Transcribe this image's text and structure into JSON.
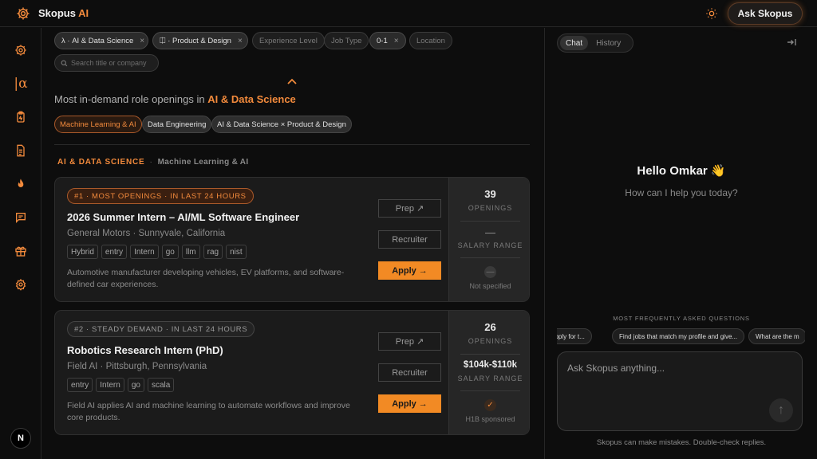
{
  "header": {
    "brand_prefix": "Skopus",
    "brand_suffix": "AI",
    "ask_button": "Ask Skopus",
    "accent": "#f28a3c"
  },
  "sidebar": {
    "items": [
      {
        "icon": "gear-icon"
      },
      {
        "icon": "alpha-icon",
        "label": "|α"
      },
      {
        "icon": "clipboard-icon"
      },
      {
        "icon": "document-icon"
      },
      {
        "icon": "flame-icon"
      },
      {
        "icon": "chat-icon"
      },
      {
        "icon": "gift-icon"
      },
      {
        "icon": "settings-icon"
      }
    ],
    "avatar": "N"
  },
  "filters": {
    "chips": [
      {
        "label": "λ · AI & Data Science",
        "active": true
      },
      {
        "label": "⎅ · Product & Design",
        "active": true
      },
      {
        "label": "Experience Level",
        "active": false
      },
      {
        "label": "Job Type",
        "active": false
      },
      {
        "label": "0-1",
        "active": true
      },
      {
        "label": "Location",
        "active": false
      }
    ],
    "remove": "×",
    "search_placeholder": "Search title or company"
  },
  "roles": {
    "heading_prefix": "Most in-demand role openings in",
    "heading_category": "AI & Data Science",
    "pills": [
      {
        "label": "Machine Learning & AI",
        "selected": true
      },
      {
        "label": "Data Engineering",
        "selected": false
      },
      {
        "label": "AI & Data Science × Product & Design",
        "selected": false
      }
    ]
  },
  "section": {
    "category": "AI & DATA SCIENCE",
    "separator": "·",
    "subcategory": "Machine Learning & AI"
  },
  "jobs": [
    {
      "badge": "#1 · MOST OPENINGS · IN LAST 24 HOURS",
      "title": "2026 Summer Intern – AI/ML Software Engineer",
      "company": "General Motors · Sunnyvale, California",
      "tags": [
        "Hybrid",
        "entry",
        "Intern",
        "go",
        "llm",
        "rag",
        "nist"
      ],
      "description": "Automotive manufacturer developing vehicles, EV platforms, and software-defined car experiences.",
      "prep": "Prep ↗",
      "recruiter": "Recruiter",
      "apply": "Apply →",
      "openings": "39",
      "openings_label": "OPENINGS",
      "salary": "—",
      "salary_label": "SALARY RANGE",
      "sponsor_symbol": "—",
      "sponsor": "Not specified"
    },
    {
      "badge": "#2 · STEADY DEMAND · IN LAST 24 HOURS",
      "title": "Robotics Research Intern (PhD)",
      "company": "Field AI · Pittsburgh, Pennsylvania",
      "tags": [
        "entry",
        "Intern",
        "go",
        "scala"
      ],
      "description": "Field AI applies AI and machine learning to automate workflows and improve core products.",
      "prep": "Prep ↗",
      "recruiter": "Recruiter",
      "apply": "Apply →",
      "openings": "26",
      "openings_label": "OPENINGS",
      "salary": "$104k-$110k",
      "salary_label": "SALARY RANGE",
      "sponsor_symbol": "✓",
      "sponsor": "H1B sponsored"
    }
  ],
  "chat": {
    "tabs": [
      "Chat",
      "History"
    ],
    "greeting": "Hello Omkar 👋",
    "subtitle": "How can I help you today?",
    "faq_label": "MOST FREQUENTLY ASKED QUESTIONS",
    "faqs": [
      "apply for t...",
      "Find jobs that match my profile and give...",
      "What are the m"
    ],
    "input_placeholder": "Ask Skopus anything...",
    "send": "↑",
    "disclaimer": "Skopus can make mistakes. Double-check replies."
  }
}
